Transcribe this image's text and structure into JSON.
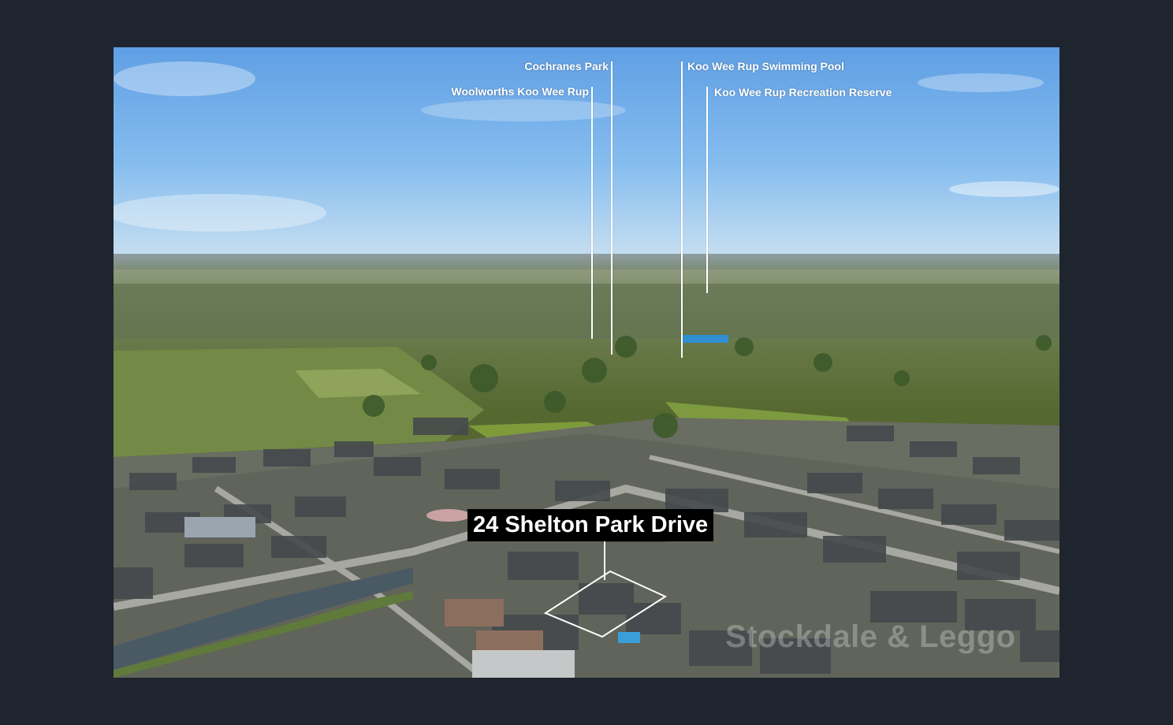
{
  "photo": {
    "alt": "Aerial view of residential estate in Koo Wee Rup",
    "sky_color": "#6aa9e8",
    "accent_color": "#000000"
  },
  "labels": {
    "cochranes_park": "Cochranes Park",
    "woolworths": "Woolworths Koo Wee Rup",
    "swimming_pool": "Koo Wee Rup Swimming Pool",
    "recreation_reserve": "Koo Wee Rup Recreation Reserve"
  },
  "address": "24 Shelton Park Drive",
  "watermark": "Stockdale & Leggo"
}
